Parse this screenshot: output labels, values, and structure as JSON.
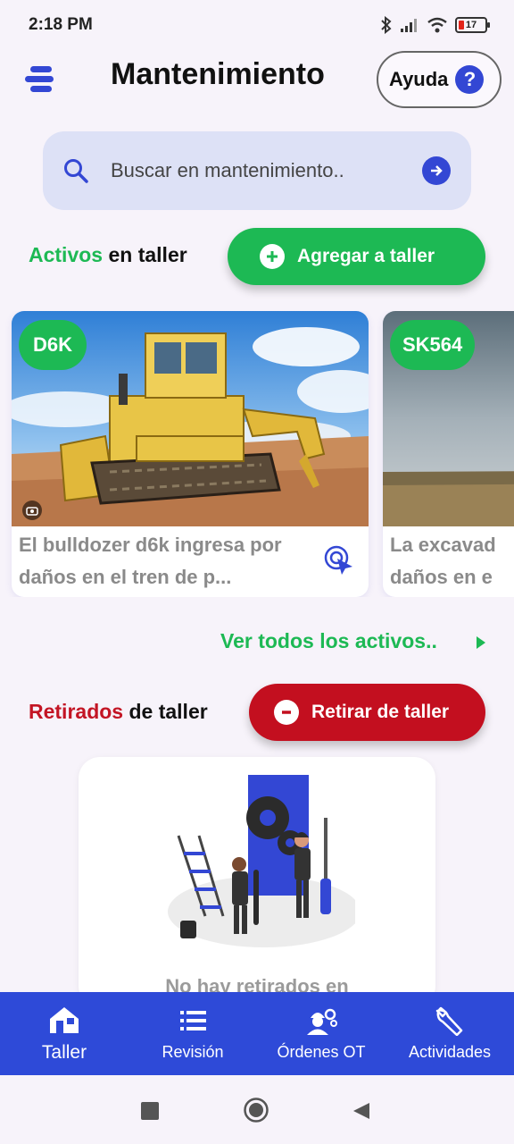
{
  "status_bar": {
    "time": "2:18 PM",
    "battery": "17",
    "icons": [
      "bluetooth-icon",
      "signal-icon",
      "wifi-icon",
      "battery-icon"
    ]
  },
  "header": {
    "title": "Mantenimiento",
    "help_label": "Ayuda",
    "help_symbol": "?"
  },
  "search": {
    "placeholder": "Buscar en mantenimiento.."
  },
  "active_section": {
    "title_highlight": "Activos",
    "title_rest": "en taller",
    "add_button": "Agregar a taller",
    "assets": [
      {
        "code": "D6K",
        "description": "El bulldozer d6k ingresa por daños en el tren de p..."
      },
      {
        "code": "SK564",
        "description": "La excavad daños en e"
      }
    ],
    "see_all": "Ver todos los activos.."
  },
  "retired_section": {
    "title_highlight": "Retirados",
    "title_rest": "de taller",
    "remove_button": "Retirar de taller",
    "empty_text": "No hay retirados en"
  },
  "bottom_nav": [
    {
      "label": "Taller",
      "icon": "workshop-icon",
      "active": true
    },
    {
      "label": "Revisión",
      "icon": "list-icon",
      "active": false
    },
    {
      "label": "Órdenes OT",
      "icon": "worker-gear-icon",
      "active": false
    },
    {
      "label": "Actividades",
      "icon": "wrench-icon",
      "active": false
    }
  ],
  "colors": {
    "primary": "#2e4ad8",
    "green": "#1db954",
    "red": "#c30f1f",
    "search_bg": "#dde1f6",
    "background": "#f7f3fa"
  }
}
